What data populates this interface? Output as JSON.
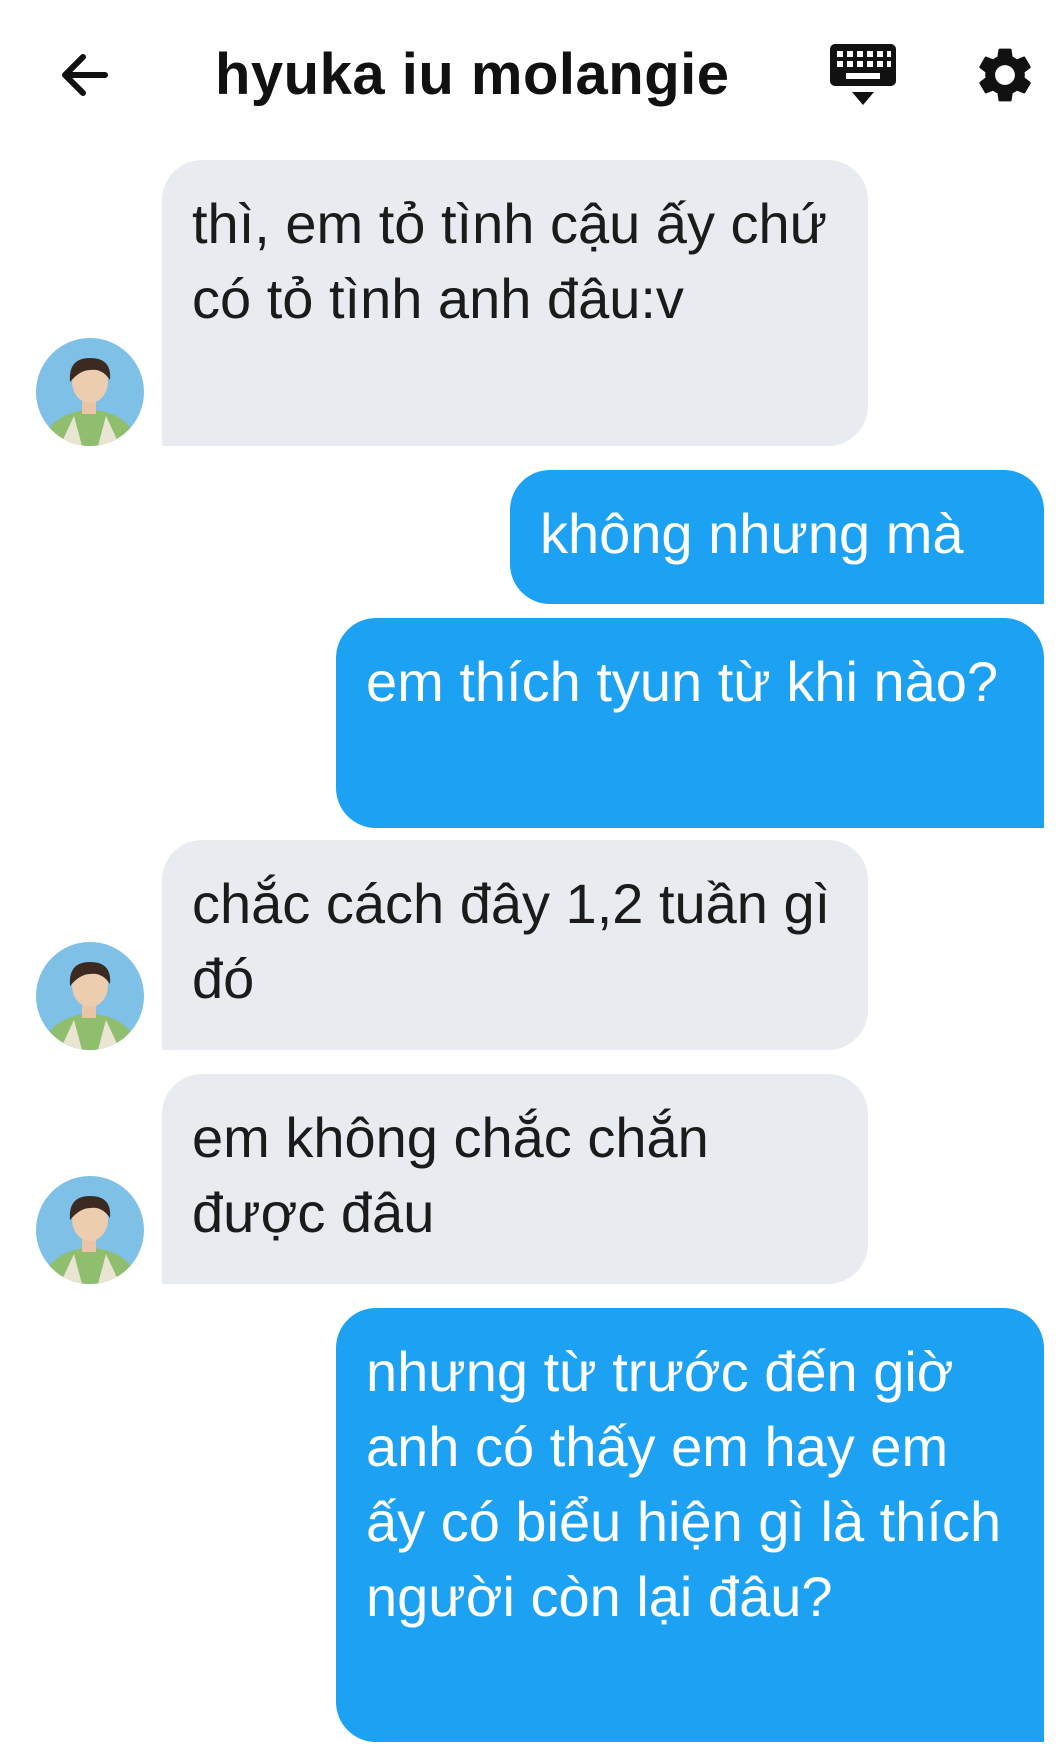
{
  "header": {
    "title": "hyuka iu molangie",
    "back_icon": "arrow-left-icon",
    "keyboard_icon": "keyboard-icon",
    "settings_icon": "gear-icon"
  },
  "colors": {
    "incoming_bubble": "#e8ecf0",
    "outgoing_bubble": "#1da1f2",
    "outgoing_text": "#ffffff",
    "incoming_text": "#1b1b1b"
  },
  "messages": [
    {
      "direction": "incoming",
      "text": "thì, em tỏ tình cậu ấy chứ có tỏ tình anh đâu:v"
    },
    {
      "direction": "outgoing",
      "text": "không nhưng mà"
    },
    {
      "direction": "outgoing",
      "text": "em thích tyun từ khi nào?"
    },
    {
      "direction": "incoming",
      "text": "chắc cách đây 1,2 tuần gì đó"
    },
    {
      "direction": "incoming",
      "text": "em không chắc chắn được đâu"
    },
    {
      "direction": "outgoing",
      "text": "nhưng từ trước đến giờ anh có thấy em hay em ấy có biểu hiện gì là thích người còn lại đâu?"
    }
  ]
}
